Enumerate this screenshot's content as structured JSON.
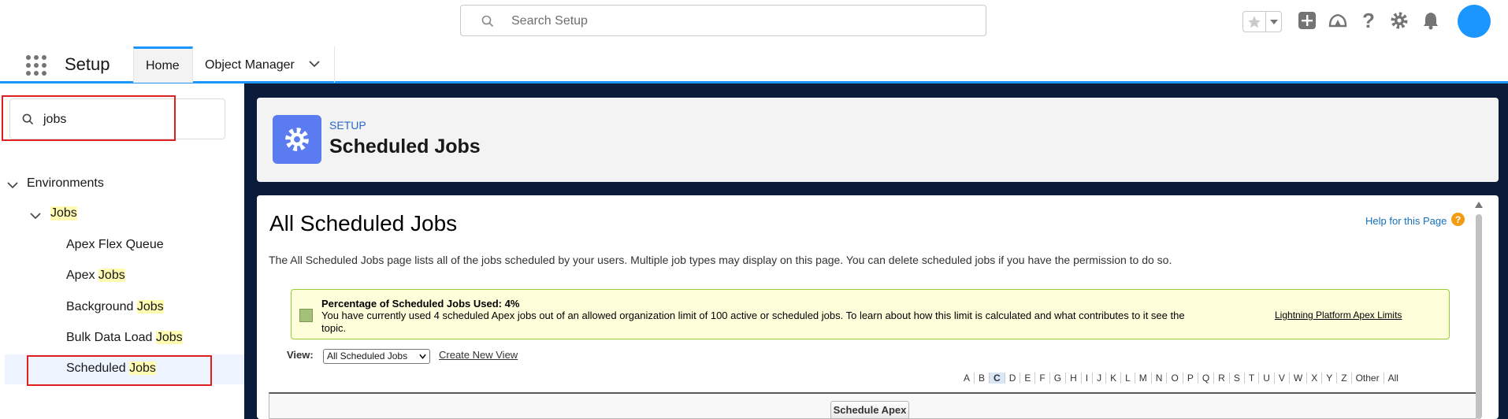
{
  "header": {
    "search_placeholder": "Search Setup"
  },
  "nav": {
    "app_name": "Setup",
    "tabs": [
      {
        "label": "Home"
      },
      {
        "label": "Object Manager"
      }
    ]
  },
  "sidebar": {
    "quick_find_value": "jobs",
    "tree": {
      "environments": "Environments",
      "jobs": "Jobs",
      "items": [
        {
          "prefix": "Apex Flex Queue",
          "hl": ""
        },
        {
          "prefix": "Apex ",
          "hl": "Jobs"
        },
        {
          "prefix": "Background ",
          "hl": "Jobs"
        },
        {
          "prefix": "Bulk Data Load ",
          "hl": "Jobs"
        },
        {
          "prefix": "Scheduled ",
          "hl": "Jobs"
        }
      ]
    }
  },
  "page_header": {
    "eyebrow": "SETUP",
    "title": "Scheduled Jobs"
  },
  "content": {
    "title": "All Scheduled Jobs",
    "help_link": "Help for this Page",
    "description": "The All Scheduled Jobs page lists all of the jobs scheduled by your users. Multiple job types may display on this page. You can delete scheduled jobs if you have the permission to do so.",
    "info_title": "Percentage of Scheduled Jobs Used: 4%",
    "info_text": "You have currently used 4 scheduled Apex jobs out of an allowed organization limit of 100 active or scheduled jobs. To learn about how this limit is calculated and what contributes to it see the topic.",
    "info_link": "Lightning Platform Apex Limits",
    "view_label": "View:",
    "view_selected": "All Scheduled Jobs",
    "create_view": "Create New View",
    "alpha": [
      "A",
      "B",
      "C",
      "D",
      "E",
      "F",
      "G",
      "H",
      "I",
      "J",
      "K",
      "L",
      "M",
      "N",
      "O",
      "P",
      "Q",
      "R",
      "S",
      "T",
      "U",
      "V",
      "W",
      "X",
      "Y",
      "Z",
      "Other",
      "All"
    ],
    "alpha_selected": "C",
    "schedule_button": "Schedule Apex"
  },
  "colors": {
    "brand": "#1b96ff",
    "main_background": "#0b1b3a",
    "highlight_box": "#e02020",
    "search_highlight": "#fffbb3",
    "setup_icon": "#5b7cf0"
  }
}
